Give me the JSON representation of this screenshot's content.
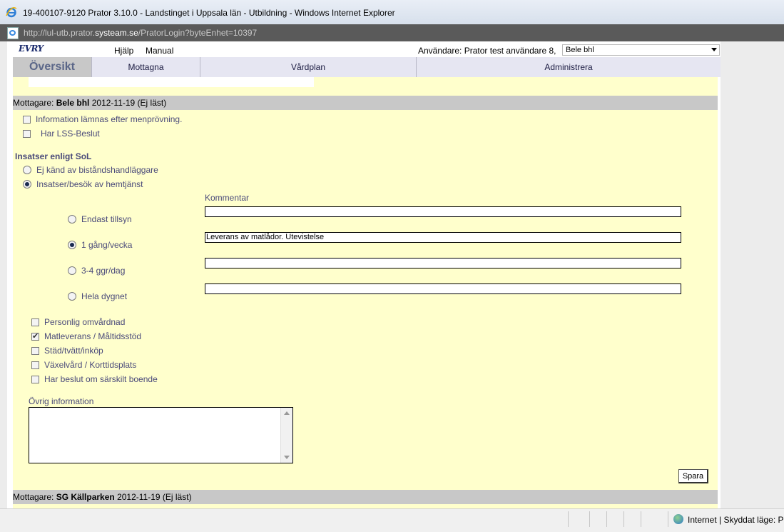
{
  "window": {
    "title": "19-400107-9120  Prator 3.10.0 - Landstinget i Uppsala län - Utbildning - Windows Internet Explorer",
    "url_prefix": "http://lul-utb.prator.",
    "url_domain": "systeam.se",
    "url_suffix": "/PratorLogin?byteEnhet=10397"
  },
  "header": {
    "logo": "EVRY",
    "help": "Hjälp",
    "manual": "Manual",
    "user_label": "Användare: Prator test användare 8,",
    "unit_selected": "Bele bhl"
  },
  "tabs": [
    "Översikt",
    "Mottagna",
    "Vårdplan",
    "Administrera"
  ],
  "receiver1": {
    "prefix": "Mottagare: ",
    "name": "Bele bhl",
    "date": " 2012-11-19  (Ej läst)"
  },
  "checks_top": [
    {
      "label": "Information lämnas efter menprövning.",
      "checked": false
    },
    {
      "label": "Har LSS-Beslut",
      "checked": false
    }
  ],
  "sol": {
    "title": "Insatser enligt SoL",
    "options": [
      {
        "label": "Ej känd av biståndshandläggare",
        "checked": false
      },
      {
        "label": "Insatser/besök av hemtjänst",
        "checked": true
      }
    ]
  },
  "frequency": {
    "comment_label": "Kommentar",
    "rows": [
      {
        "label": "Endast tillsyn",
        "checked": false,
        "comment": ""
      },
      {
        "label": "1 gång/vecka",
        "checked": true,
        "comment": "Leverans av matlådor. Utevistelse"
      },
      {
        "label": "3-4 ggr/dag",
        "checked": false,
        "comment": ""
      },
      {
        "label": "Hela dygnet",
        "checked": false,
        "comment": ""
      }
    ]
  },
  "services": [
    {
      "label": "Personlig omvårdnad",
      "checked": false
    },
    {
      "label": "Matleverans / Måltidsstöd",
      "checked": true
    },
    {
      "label": "Städ/tvätt/inköp",
      "checked": false
    },
    {
      "label": "Växelvård / Korttidsplats",
      "checked": false
    },
    {
      "label": "Har beslut om särskilt boende",
      "checked": false
    }
  ],
  "other_info": {
    "label": "Övrig information",
    "value": ""
  },
  "save_label": "Spara",
  "receiver2": {
    "prefix": "Mottagare: ",
    "name": "SG Källparken",
    "date": " 2012-11-19  (Ej läst)"
  },
  "status": {
    "zone": "Internet | Skyddat läge: På"
  }
}
